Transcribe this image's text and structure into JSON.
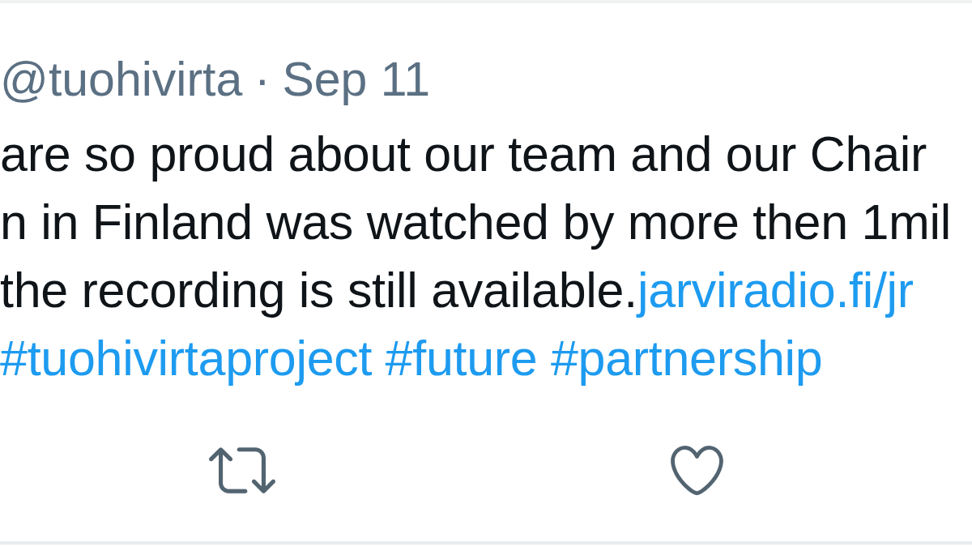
{
  "tweet": {
    "handle": "@tuohivirta",
    "separator": "·",
    "date": "Sep 11",
    "lines": [
      {
        "segments": [
          {
            "kind": "text",
            "text": "are so proud about our team and our Chair"
          }
        ]
      },
      {
        "segments": [
          {
            "kind": "text",
            "text": "n in Finland was watched by more then 1mil"
          }
        ]
      },
      {
        "segments": [
          {
            "kind": "text",
            "text": "the recording is still available."
          },
          {
            "kind": "link",
            "text": "jarviradio.fi/jr"
          }
        ]
      },
      {
        "segments": [
          {
            "kind": "hashtag",
            "text": "#tuohivirtaproject"
          },
          {
            "kind": "hashtag",
            "text": "#future"
          },
          {
            "kind": "hashtag",
            "text": "#partnership"
          }
        ]
      }
    ],
    "actions": [
      {
        "kind": "retweet"
      },
      {
        "kind": "like",
        "liked": false
      }
    ]
  }
}
